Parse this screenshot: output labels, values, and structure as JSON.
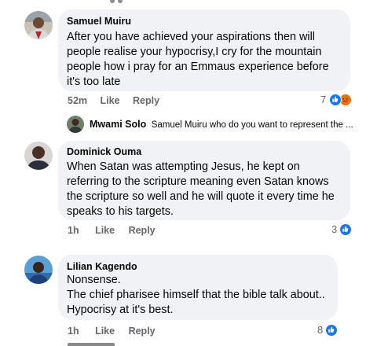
{
  "comments": [
    {
      "author": "Samuel Muiru",
      "lines": [
        "After you have achieved your aspirations then will",
        "people realise your hypocrisy,I cry for the mountain",
        "people how i pray for an Emmaus experience before",
        "it's too late"
      ],
      "time": "52m",
      "like_label": "Like",
      "reply_label": "Reply",
      "reaction_count": "7",
      "reactions": [
        "like-icon",
        "angry-icon"
      ]
    },
    {
      "author": "Dominick Ouma",
      "lines": [
        "When Satan was attempting Jesus, he kept on",
        "referring to the scripture meaning even Satan knows",
        "the scripture so well and he will quote it every time he",
        "speaks to his targets."
      ],
      "time": "1h",
      "like_label": "Like",
      "reply_label": "Reply",
      "reaction_count": "3",
      "reactions": [
        "like-icon"
      ]
    },
    {
      "author": "Lilian Kagendo",
      "lines": [
        "Nonsense.",
        "The chief pharisee himself that the bible talk about..",
        "Hypocrisy at it's best."
      ],
      "time": "1h",
      "like_label": "Like",
      "reply_label": "Reply",
      "reaction_count": "8",
      "reactions": [
        "like-icon"
      ]
    }
  ],
  "reply_preview": {
    "author": "Mwami Solo",
    "text": "Samuel Muiru who do you want to represent the ..."
  },
  "colors": {
    "bubble": "#f0f2f5",
    "meta": "#65676b",
    "like": "#1877f2",
    "angry": "#e9710f"
  }
}
